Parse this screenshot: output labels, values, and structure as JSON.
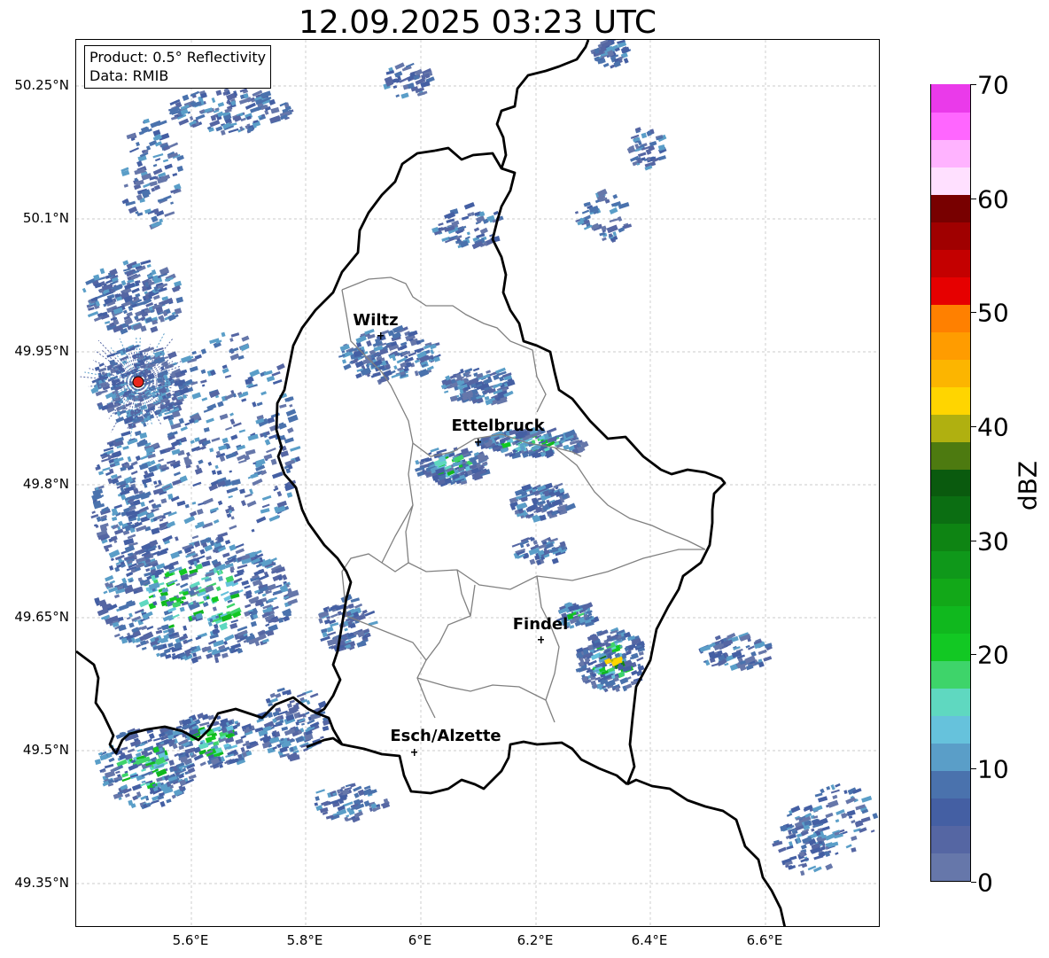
{
  "title": "12.09.2025 03:23 UTC",
  "info": {
    "product": "Product: 0.5° Reflectivity",
    "data": "Data: RMIB"
  },
  "axes": {
    "y_ticks": [
      "50.25°N",
      "50.1°N",
      "49.95°N",
      "49.8°N",
      "49.65°N",
      "49.5°N",
      "49.35°N"
    ],
    "x_ticks": [
      "5.6°E",
      "5.8°E",
      "6°E",
      "6.2°E",
      "6.4°E",
      "6.6°E"
    ]
  },
  "cities": [
    {
      "name": "Wiltz"
    },
    {
      "name": "Ettelbruck"
    },
    {
      "name": "Findel"
    },
    {
      "name": "Esch/Alzette"
    }
  ],
  "radar_site": {
    "color": "#e8261c"
  },
  "colorbar": {
    "label": "dBZ",
    "ticks": [
      "0",
      "10",
      "20",
      "30",
      "40",
      "50",
      "60",
      "70"
    ],
    "colors": [
      "#6677aa",
      "#5566a3",
      "#445fa3",
      "#4a72ad",
      "#5a9ec8",
      "#66c2dc",
      "#5fd8c0",
      "#3ed46a",
      "#12c823",
      "#10b81e",
      "#12a818",
      "#0f981a",
      "#0e8413",
      "#0b6e12",
      "#0a5a0e",
      "#4d7a10",
      "#b0b010",
      "#ffd500",
      "#fcb500",
      "#ff9c00",
      "#ff8000",
      "#e60000",
      "#c40000",
      "#a00000",
      "#780000",
      "#ffe0ff",
      "#ffb3ff",
      "#ff66ff",
      "#ea3aea"
    ]
  }
}
